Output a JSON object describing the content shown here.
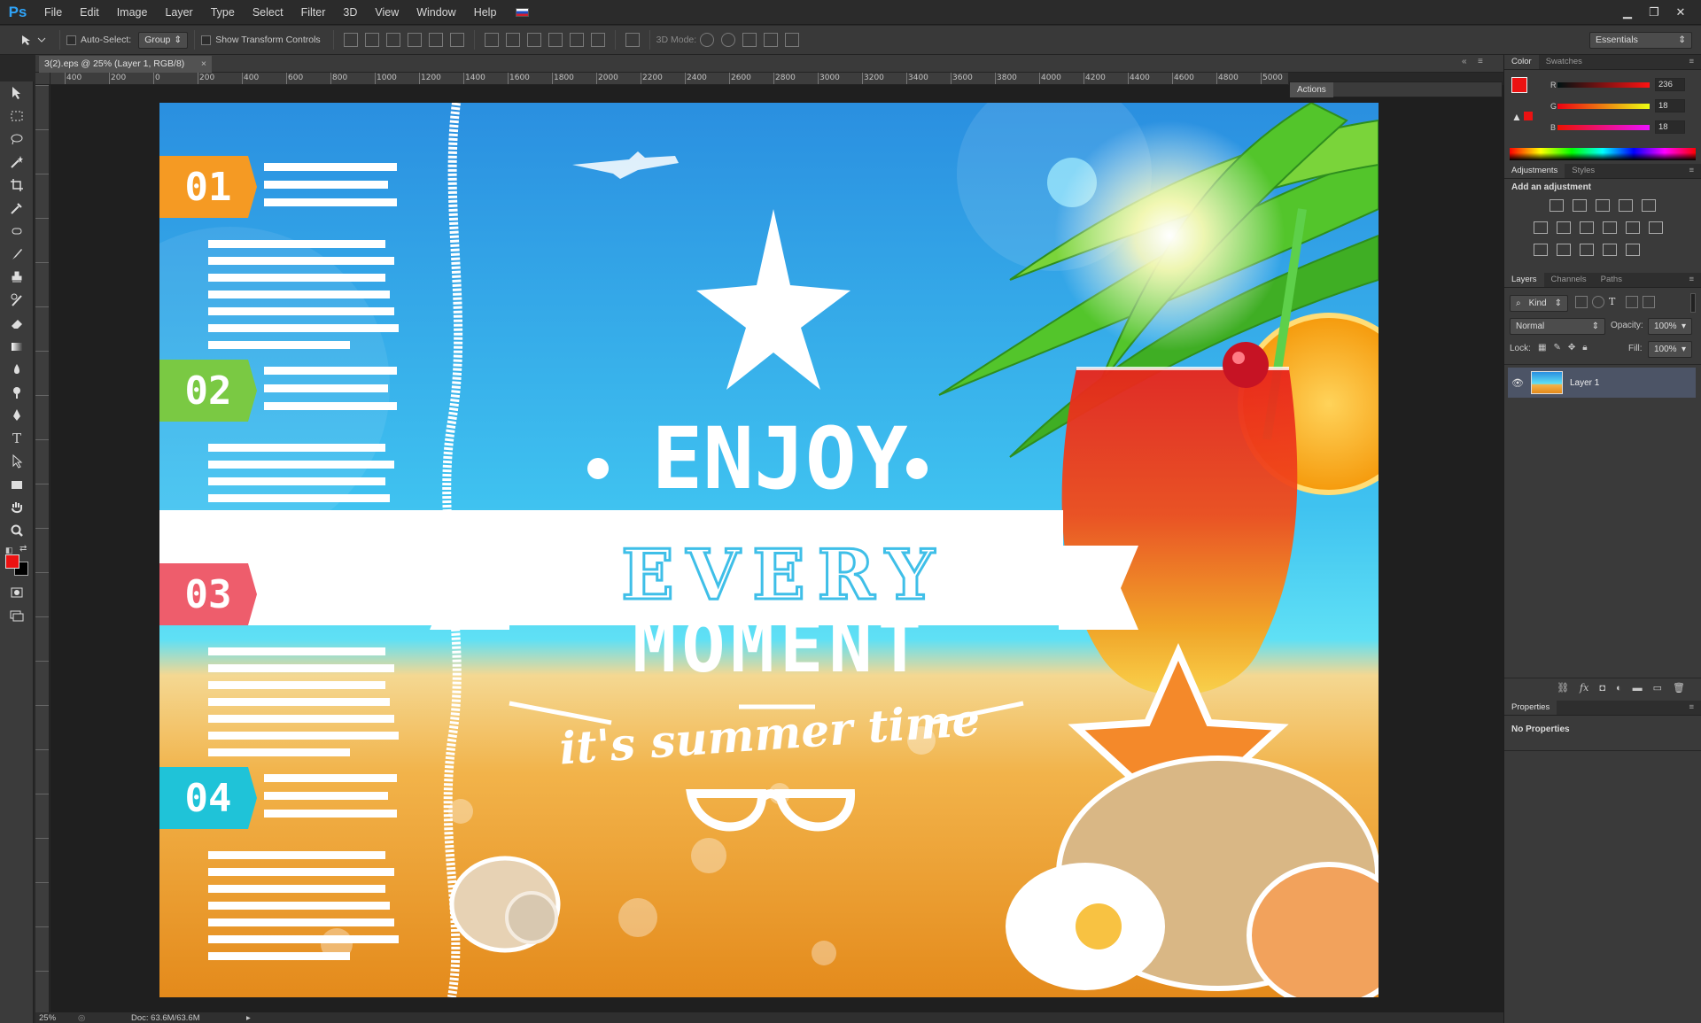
{
  "app": {
    "logo": "Ps"
  },
  "menu": [
    "File",
    "Edit",
    "Image",
    "Layer",
    "Type",
    "Select",
    "Filter",
    "3D",
    "View",
    "Window",
    "Help"
  ],
  "window_buttons": {
    "minimize": "▁",
    "restore": "❐",
    "close": "✕"
  },
  "options": {
    "auto_select_label": "Auto-Select:",
    "auto_select_value": "Group",
    "transform_label": "Show Transform Controls",
    "mode_3d_label": "3D Mode:",
    "workspace": "Essentials"
  },
  "document": {
    "tab_title": "3(2).eps @ 25% (Layer 1, RGB/8)",
    "zoom": "25%",
    "doc_size": "Doc: 63.6M/63.6M"
  },
  "ruler": {
    "top_ticks": [
      "400",
      "200",
      "0",
      "200",
      "400",
      "600",
      "800",
      "1000",
      "1200",
      "1400",
      "1600",
      "1800",
      "2000",
      "2200",
      "2400",
      "2600",
      "2800",
      "3000",
      "3200",
      "3400",
      "3600",
      "3800",
      "4000",
      "4200",
      "4400",
      "4600",
      "4800",
      "5000"
    ]
  },
  "artwork": {
    "steps": [
      {
        "num": "01",
        "color": "#f59a23"
      },
      {
        "num": "02",
        "color": "#7ac943"
      },
      {
        "num": "03",
        "color": "#ee5d6c"
      },
      {
        "num": "04",
        "color": "#1fc3d8"
      }
    ],
    "line1": "ENJOY",
    "line2": "EVERY",
    "line3": "MOMENT",
    "tagline": "it's summer time"
  },
  "panels": {
    "actions_tab": "Actions",
    "color_tabs": [
      "Color",
      "Swatches"
    ],
    "rgb": [
      {
        "ch": "R",
        "value": "236"
      },
      {
        "ch": "G",
        "value": "18"
      },
      {
        "ch": "B",
        "value": "18"
      }
    ],
    "fg_color": "#ec1212",
    "adjust_tabs": [
      "Adjustments",
      "Styles"
    ],
    "adjust_title": "Add an adjustment",
    "layers_tabs": [
      "Layers",
      "Channels",
      "Paths"
    ],
    "filter_kind": "Kind",
    "blend_mode": "Normal",
    "opacity_label": "Opacity:",
    "opacity_value": "100%",
    "lock_label": "Lock:",
    "fill_label": "Fill:",
    "fill_value": "100%",
    "layer_name": "Layer 1",
    "properties_tab": "Properties",
    "no_properties": "No Properties"
  }
}
